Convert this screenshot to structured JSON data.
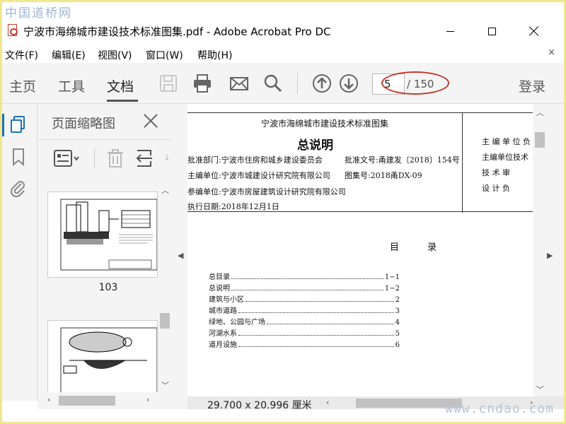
{
  "watermark_top": "中国道桥网",
  "watermark_bottom": "www.cndao.com",
  "window": {
    "title": "宁波市海绵城市建设技术标准图集.pdf - Adobe Acrobat Pro DC"
  },
  "menu": {
    "items": [
      "文件(F)",
      "编辑(E)",
      "视图(V)",
      "窗口(W)",
      "帮助(H)"
    ],
    "close_glyph": "×"
  },
  "toolbar": {
    "tabs": [
      "主页",
      "工具",
      "文档"
    ],
    "active_tab": "文档",
    "icons": [
      "save-icon",
      "print-icon",
      "email-icon",
      "search-icon",
      "page-up-icon",
      "page-down-icon"
    ],
    "page_current": "5",
    "page_total": "/ 150",
    "login_label": "登录",
    "highlight_color": "#c0392b"
  },
  "sidebar_rail": {
    "icons": [
      "pages-icon",
      "bookmark-icon",
      "attachment-icon"
    ],
    "accent_color": "#1a73b8"
  },
  "thumbnail_pane": {
    "title": "页面缩略图",
    "tools": [
      "page-options-icon",
      "delete-icon",
      "insert-page-icon"
    ],
    "thumbnails": [
      {
        "label": "103"
      },
      {
        "label": ""
      }
    ]
  },
  "document": {
    "header_title": "宁波市海绵城市建设技术标准图集",
    "main_title": "总说明",
    "rows": [
      {
        "left": "批准部门:宁波市住房和城乡建设委员会",
        "right": "批准文号:甬建发〔2018〕154号"
      },
      {
        "left": "主编单位:宁波市城建设计研究院有限公司",
        "right": "图集号:2018甬DX-09"
      },
      {
        "left": "参编单位:宁波市房屋建筑设计研究院有限公司",
        "right": ""
      },
      {
        "left": "执行日期:2018年12月1日",
        "right": ""
      }
    ],
    "right_column": [
      "主 编 单 位 负",
      "主编单位技术",
      "技  术  审  ",
      "设  计  负  "
    ],
    "toc_title": "目 录",
    "toc": [
      {
        "label": "总目录",
        "page": "1−1"
      },
      {
        "label": "总说明",
        "page": "1−2"
      },
      {
        "label": "建筑与小区",
        "page": "2"
      },
      {
        "label": "城市道路",
        "page": "3"
      },
      {
        "label": "绿地、公园与广场",
        "page": "4"
      },
      {
        "label": "河湖水系",
        "page": "5"
      },
      {
        "label": "道月设施",
        "page": "6"
      }
    ],
    "page_size": "29.700 x 20.996 厘米"
  }
}
